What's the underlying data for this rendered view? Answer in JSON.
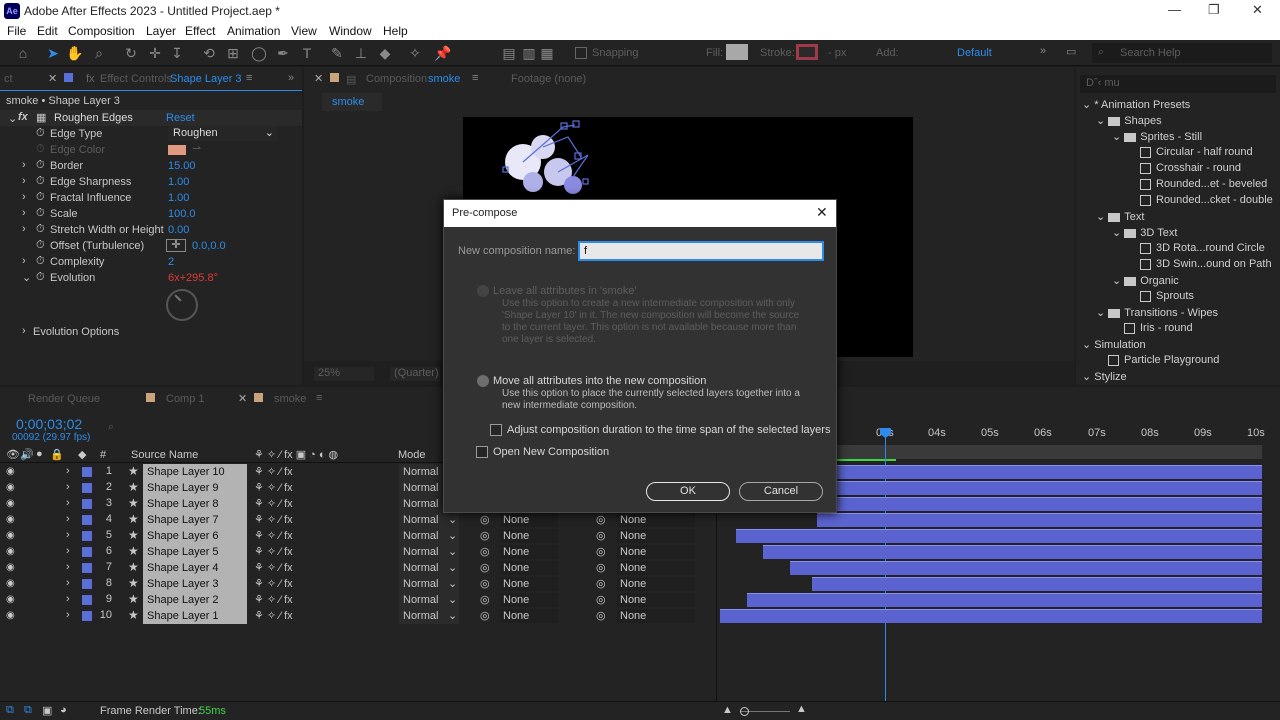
{
  "window": {
    "title": "Adobe After Effects 2023 - Untitled Project.aep *",
    "logo": "Ae"
  },
  "menu": [
    "File",
    "Edit",
    "Composition",
    "Layer",
    "Effect",
    "Animation",
    "View",
    "Window",
    "Help"
  ],
  "toolbar": {
    "snapping_label": "Snapping",
    "fill_label": "Fill:",
    "stroke_label": "Stroke:",
    "stroke_px": "- px",
    "add_label": "Add:",
    "workspace": "Default",
    "search_placeholder": "Search Help"
  },
  "effect_controls": {
    "tab_prefix": "ct",
    "tab_label": "Effect Controls",
    "tab_layer": "Shape Layer 3",
    "header": "smoke • Shape Layer 3",
    "effect_name": "Roughen Edges",
    "reset_label": "Reset",
    "properties": [
      {
        "name": "Edge Type",
        "value": "Roughen"
      },
      {
        "name": "Edge Color",
        "value": ""
      },
      {
        "name": "Border",
        "value": "15.00"
      },
      {
        "name": "Edge Sharpness",
        "value": "1.00"
      },
      {
        "name": "Fractal Influence",
        "value": "1.00"
      },
      {
        "name": "Scale",
        "value": "100.0"
      },
      {
        "name": "Stretch Width or Height",
        "value": "0.00"
      },
      {
        "name": "Offset (Turbulence)",
        "value": "0.0,0.0"
      },
      {
        "name": "Complexity",
        "value": "2"
      },
      {
        "name": "Evolution",
        "value": "6x+295.8°"
      }
    ],
    "evolution_options": "Evolution Options"
  },
  "composition": {
    "tab_label": "Composition",
    "tab_name": "smoke",
    "footage_tab": "Footage (none)",
    "comp_subtab": "smoke",
    "zoom": "25%",
    "quality": "(Quarter)"
  },
  "effects_presets": {
    "search_placeholder": "Dˆ‹ mu",
    "items": [
      {
        "label": "* Animation Presets",
        "kind": "root"
      },
      {
        "label": "Shapes",
        "kind": "folder"
      },
      {
        "label": "Sprites - Still",
        "kind": "folder"
      },
      {
        "label": "Circular - half round",
        "kind": "preset"
      },
      {
        "label": "Crosshair - round",
        "kind": "preset"
      },
      {
        "label": "Rounded...et - beveled",
        "kind": "preset"
      },
      {
        "label": "Rounded...cket - double",
        "kind": "preset"
      },
      {
        "label": "Text",
        "kind": "folder"
      },
      {
        "label": "3D Text",
        "kind": "folder"
      },
      {
        "label": "3D Rota...round Circle",
        "kind": "preset"
      },
      {
        "label": "3D Swin...ound on Path",
        "kind": "preset"
      },
      {
        "label": "Organic",
        "kind": "folder"
      },
      {
        "label": "Sprouts",
        "kind": "preset"
      },
      {
        "label": "Transitions - Wipes",
        "kind": "folder"
      },
      {
        "label": "Iris - round",
        "kind": "preset"
      },
      {
        "label": "Simulation",
        "kind": "root"
      },
      {
        "label": "Particle Playground",
        "kind": "preset"
      },
      {
        "label": "Stylize",
        "kind": "root"
      }
    ]
  },
  "timeline": {
    "tabs": [
      "Render Queue",
      "Comp 1",
      "smoke"
    ],
    "timecode": "0;00;03;02",
    "frames": "00092 (29.97 fps)",
    "source_name_header": "Source Name",
    "mode_header": "Mode",
    "ruler": [
      "03s",
      "04s",
      "05s",
      "06s",
      "07s",
      "08s",
      "09s",
      "10s"
    ],
    "layers": [
      {
        "num": "1",
        "name": "Shape Layer 10",
        "mode": "Normal",
        "trkmat": "",
        "parent": "",
        "bar_start": 0
      },
      {
        "num": "2",
        "name": "Shape Layer 9",
        "mode": "Normal",
        "trkmat": "",
        "parent": "",
        "bar_start": 0
      },
      {
        "num": "3",
        "name": "Shape Layer 8",
        "mode": "Normal",
        "trkmat": "",
        "parent": "",
        "bar_start": 0
      },
      {
        "num": "4",
        "name": "Shape Layer 7",
        "mode": "Normal",
        "trkmat": "None",
        "parent": "None",
        "bar_start": 0.18
      },
      {
        "num": "5",
        "name": "Shape Layer 6",
        "mode": "Normal",
        "trkmat": "None",
        "parent": "None",
        "bar_start": 0.03
      },
      {
        "num": "6",
        "name": "Shape Layer 5",
        "mode": "Normal",
        "trkmat": "None",
        "parent": "None",
        "bar_start": 0.08
      },
      {
        "num": "7",
        "name": "Shape Layer 4",
        "mode": "Normal",
        "trkmat": "None",
        "parent": "None",
        "bar_start": 0.13
      },
      {
        "num": "8",
        "name": "Shape Layer 3",
        "mode": "Normal",
        "trkmat": "None",
        "parent": "None",
        "bar_start": 0.17
      },
      {
        "num": "9",
        "name": "Shape Layer 2",
        "mode": "Normal",
        "trkmat": "None",
        "parent": "None",
        "bar_start": 0.05
      },
      {
        "num": "10",
        "name": "Shape Layer 1",
        "mode": "Normal",
        "trkmat": "None",
        "parent": "None",
        "bar_start": 0.0
      }
    ]
  },
  "statusbar": {
    "render_label": "Frame Render Time:",
    "render_value": "55ms"
  },
  "dialog": {
    "title": "Pre-compose",
    "name_label": "New composition name:",
    "name_value": "f",
    "option1_label": "Leave all attributes in 'smoke'",
    "option1_desc": "Use this option to create a new intermediate composition with only 'Shape Layer 10' in it. The new composition will become the source to the current layer. This option is not available because more than one layer is selected.",
    "option2_label": "Move all attributes into the new composition",
    "option2_desc": "Use this option to place the currently selected layers together into a new intermediate composition.",
    "adjust_label": "Adjust composition duration to the time span of the selected layers",
    "open_label": "Open New Composition",
    "ok_label": "OK",
    "cancel_label": "Cancel"
  },
  "colors": {
    "accent": "#2d8ceb",
    "layer_label": "#5a6fd8",
    "layer_bar": "#5b63d0",
    "keyframe_red": "#e03a3a"
  }
}
